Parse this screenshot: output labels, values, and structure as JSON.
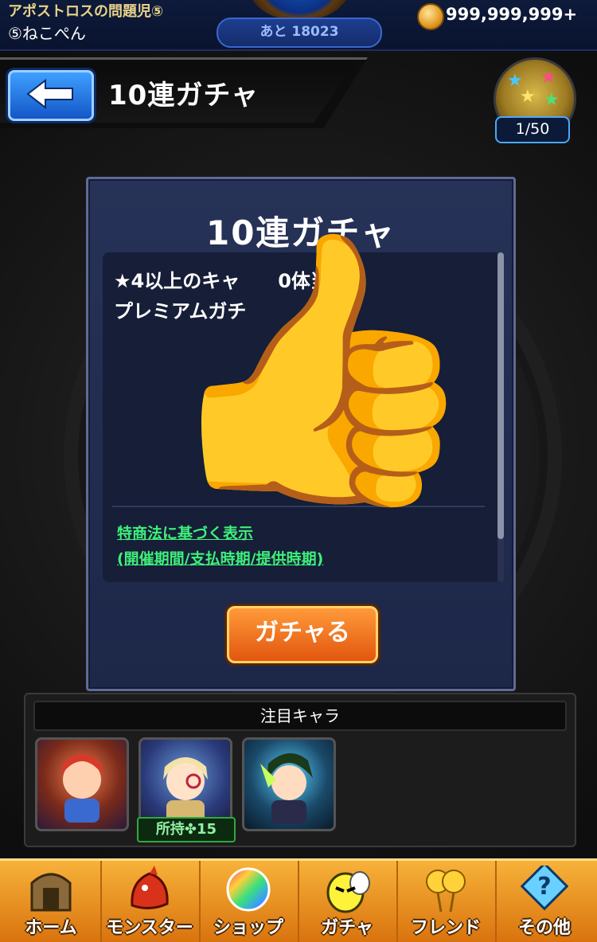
{
  "status": {
    "player_title": "アポストロスの問題児⑤",
    "player_name": "⑤ねこぺん",
    "exp_remaining": "あと 18023",
    "coins": "999,999,999+"
  },
  "header": {
    "page_title": "10連ガチャ",
    "orb_count": "1/50"
  },
  "panel": {
    "title": "10連ガチャ",
    "description_line1": "★4以上のキャ　　0体当たる",
    "description_line2": "プレミアムガチ",
    "legal_link_line1": "特商法に基づく表示",
    "legal_link_line2": "(開催期間/支払時期/提供時期)",
    "gacha_button_label": "ガチャる"
  },
  "overlay": {
    "emoji": "👍"
  },
  "featured": {
    "header": "注目キャラ",
    "owned_label": "所持✤15"
  },
  "nav": {
    "items": [
      {
        "label": "ホーム",
        "icon": "home-gate-icon"
      },
      {
        "label": "モンスター",
        "icon": "dragon-icon"
      },
      {
        "label": "ショップ",
        "icon": "rainbow-orb-icon"
      },
      {
        "label": "ガチャ",
        "icon": "egg-icon"
      },
      {
        "label": "フレンド",
        "icon": "balloons-icon"
      },
      {
        "label": "その他",
        "icon": "question-icon"
      }
    ]
  },
  "colors": {
    "accent_orange": "#e2560e",
    "link_green": "#3ef07a",
    "panel_navy": "#263257"
  }
}
